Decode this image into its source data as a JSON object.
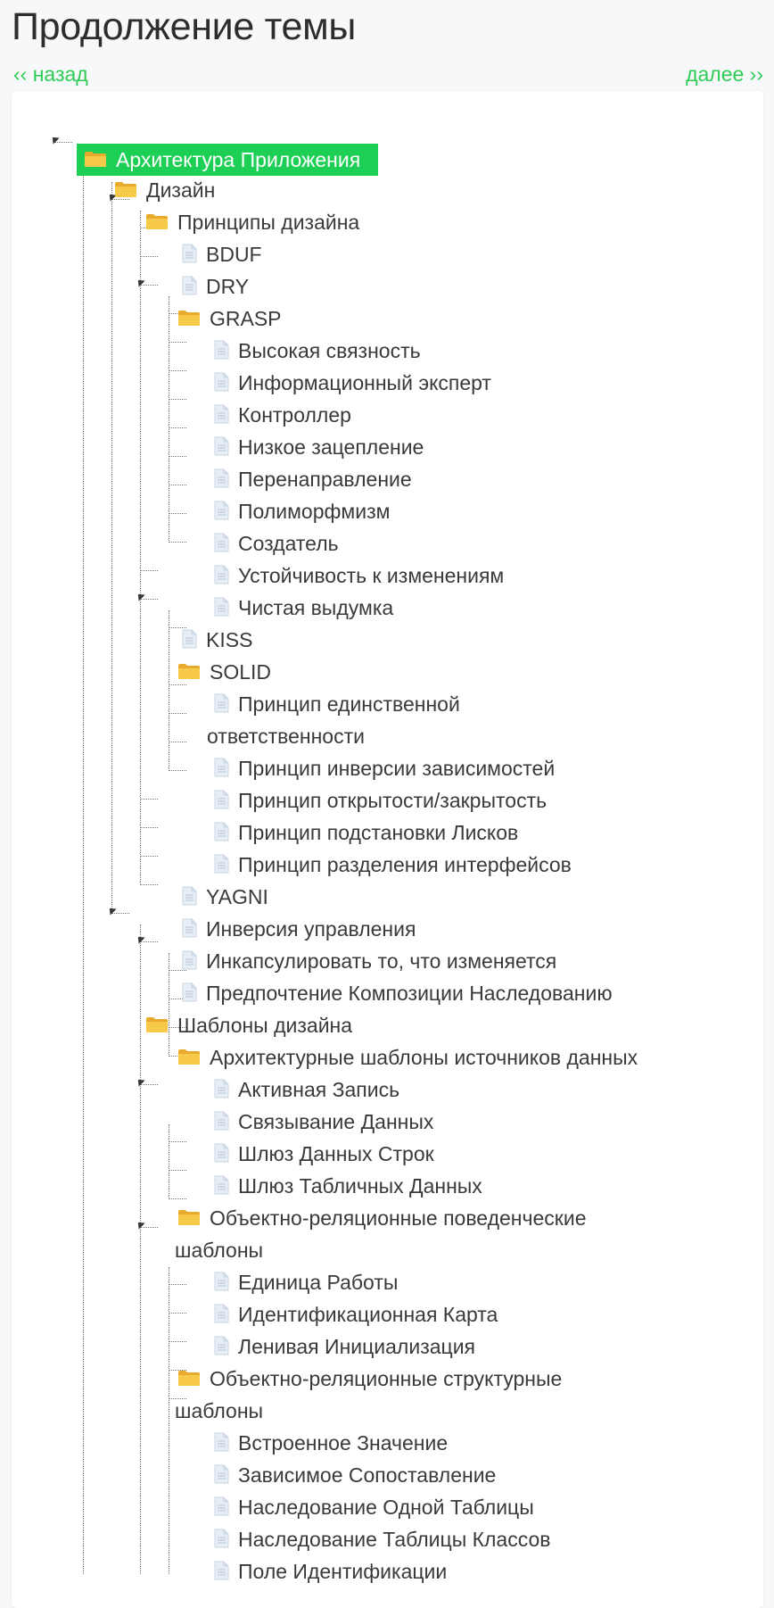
{
  "page": {
    "title": "Продолжение темы"
  },
  "nav": {
    "prev_label": "‹‹ назад",
    "next_label": "далее ››"
  },
  "colors": {
    "accent": "#1ecf55",
    "nav": "#2ecc55",
    "folder": "#f5c444",
    "file": "#cfd9e6"
  },
  "tree": {
    "root": "Архитектура Приложения",
    "design": "Дизайн",
    "design_principles": "Принципы дизайна",
    "bduf": "BDUF",
    "dry": "DRY",
    "grasp": "GRASP",
    "grasp_items": [
      "Высокая связность",
      "Информационный эксперт",
      "Контроллер",
      "Низкое зацепление",
      "Перенаправление",
      "Полиморфмизм",
      "Создатель",
      "Устойчивость к изменениям",
      "Чистая выдумка"
    ],
    "kiss": "KISS",
    "solid": "SOLID",
    "solid_srp_line1": "Принцип единственной",
    "solid_srp_line2": "ответственности",
    "solid_items": [
      "Принцип инверсии зависимостей",
      "Принцип открытости/закрытость",
      "Принцип подстановки Лисков",
      "Принцип разделения интерфейсов"
    ],
    "principles_tail": [
      "YAGNI",
      "Инверсия управления",
      "Инкапсулировать то, что изменяется",
      "Предпочтение Композиции Наследованию"
    ],
    "design_patterns": "Шаблоны дизайна",
    "data_source_patterns": "Архитектурные шаблоны источников данных",
    "data_source_items": [
      "Активная Запись",
      "Связывание Данных",
      "Шлюз Данных Строк",
      "Шлюз Табличных Данных"
    ],
    "or_behavioral_line1": "Объектно-реляционные поведенческие",
    "or_behavioral_line2": "шаблоны",
    "or_behavioral_items": [
      "Единица Работы",
      "Идентификационная Карта",
      "Ленивая Инициализация"
    ],
    "or_structural_line1": "Объектно-реляционные структурные",
    "or_structural_line2": "шаблоны",
    "or_structural_items": [
      "Встроенное Значение",
      "Зависимое Сопоставление",
      "Наследование Одной Таблицы",
      "Наследование Таблицы Классов",
      "Поле Идентификации"
    ]
  }
}
